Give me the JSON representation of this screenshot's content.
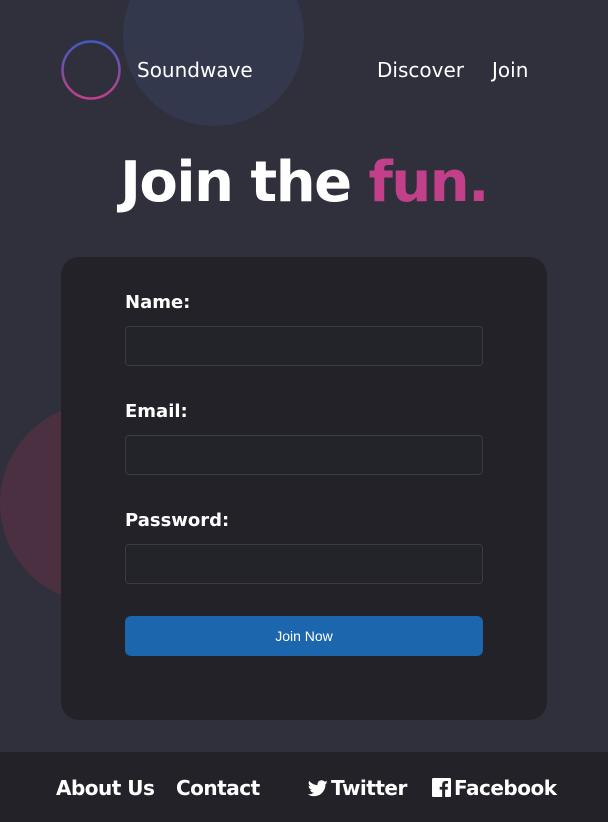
{
  "brand": {
    "name": "Soundwave"
  },
  "nav": {
    "items": [
      {
        "label": "Discover"
      },
      {
        "label": "Join"
      }
    ]
  },
  "hero": {
    "title_main": "Join the ",
    "title_accent": "fun."
  },
  "form": {
    "name_label": "Name:",
    "name_value": "",
    "email_label": "Email:",
    "email_value": "",
    "password_label": "Password:",
    "password_value": "",
    "submit_label": "Join Now"
  },
  "footer": {
    "links": [
      {
        "label": "About Us"
      },
      {
        "label": "Contact"
      },
      {
        "label": "Twitter",
        "icon": "twitter-icon"
      },
      {
        "label": "Facebook",
        "icon": "facebook-icon"
      }
    ]
  },
  "colors": {
    "background": "#30303c",
    "card": "#222228",
    "accent": "#c2408a",
    "button": "#1b66ad"
  }
}
